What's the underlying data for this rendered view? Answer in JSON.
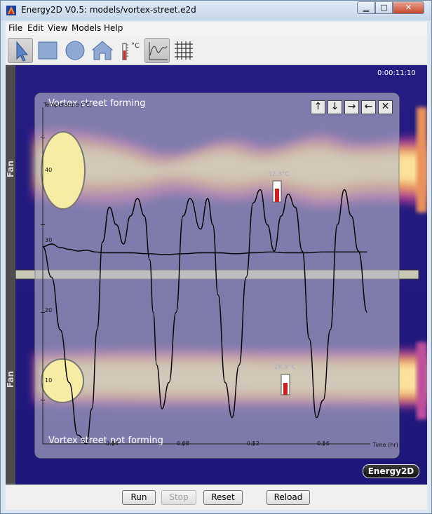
{
  "window": {
    "title": "Energy2D V0.5: models/vortex-street.e2d",
    "min_label": "▁",
    "max_label": "□",
    "close_label": "✕"
  },
  "menu": [
    "File",
    "Edit",
    "View",
    "Models",
    "Help"
  ],
  "toolbar": {
    "tools": [
      "select-arrow-icon",
      "rectangle-icon",
      "ellipse-icon",
      "house-polygon-icon",
      "thermometer-icon",
      "graph-icon",
      "grid-icon"
    ],
    "thermometer_unit": "°C"
  },
  "simulation": {
    "clock": "0:00:11:10",
    "fan_top_label": "Fan",
    "fan_bottom_label": "Fan",
    "note_top": "Vortex street forming",
    "note_bottom": "Vortex street not forming",
    "thermometer_top_label": "32.3°C",
    "thermometer_bottom_label": "28.9°C",
    "logo": "Energy2D"
  },
  "graph": {
    "buttons": [
      "↑",
      "↓",
      "→",
      "←",
      "✕"
    ]
  },
  "chart_data": {
    "type": "line",
    "xlabel": "Time (hr)",
    "ylabel": "Temperature (°C)",
    "x_ticks": [
      "0.04",
      "0.08",
      "0.12",
      "0.16"
    ],
    "y_ticks": [
      "10",
      "20",
      "30",
      "40"
    ],
    "xlim": [
      0,
      0.186
    ],
    "ylim": [
      5,
      45
    ],
    "series": [
      {
        "x": [
          0,
          0.005,
          0.01,
          0.015,
          0.02,
          0.025,
          0.03,
          0.035,
          0.04,
          0.05,
          0.06,
          0.07,
          0.08,
          0.09,
          0.1,
          0.11,
          0.12,
          0.13,
          0.14,
          0.15,
          0.16,
          0.17,
          0.18,
          0.185
        ],
        "values": [
          27.5,
          27.8,
          27.4,
          27.2,
          27.0,
          27.1,
          26.9,
          26.8,
          26.8,
          26.8,
          26.7,
          26.6,
          26.7,
          26.8,
          26.8,
          26.7,
          26.8,
          26.9,
          26.8,
          26.8,
          26.9,
          26.9,
          26.9,
          26.9
        ],
        "color": "#000000"
      },
      {
        "x": [
          0,
          0.005,
          0.01,
          0.015,
          0.02,
          0.025,
          0.028,
          0.031,
          0.034,
          0.038,
          0.042,
          0.046,
          0.05,
          0.054,
          0.058,
          0.061,
          0.063,
          0.065,
          0.068,
          0.072,
          0.076,
          0.08,
          0.084,
          0.09,
          0.094,
          0.097,
          0.1,
          0.104,
          0.108,
          0.112,
          0.116,
          0.12,
          0.124,
          0.128,
          0.132,
          0.136,
          0.14,
          0.144,
          0.148,
          0.152,
          0.156,
          0.16,
          0.164,
          0.168,
          0.172,
          0.176,
          0.18,
          0.185
        ],
        "values": [
          27.5,
          24,
          18,
          12,
          6,
          5,
          9,
          18,
          28,
          32,
          30,
          27.8,
          31,
          33,
          31,
          26,
          20,
          14,
          9,
          12,
          20,
          31,
          33,
          29.5,
          33,
          30,
          22,
          12,
          8,
          14,
          24,
          32.5,
          34,
          30,
          27,
          31,
          33.5,
          32,
          27,
          17,
          8,
          10,
          18,
          30,
          34,
          31,
          27,
          20
        ]
      }
    ]
  }
}
